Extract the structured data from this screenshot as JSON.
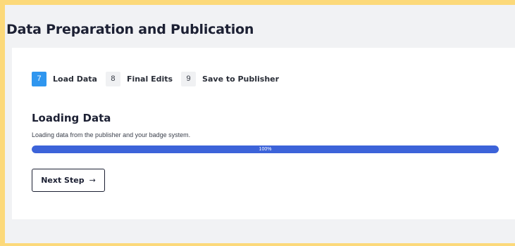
{
  "page": {
    "title": "Data Preparation and Publication"
  },
  "steps": [
    {
      "number": "7",
      "label": "Load Data",
      "active": true
    },
    {
      "number": "8",
      "label": "Final Edits",
      "active": false
    },
    {
      "number": "9",
      "label": "Save to Publisher",
      "active": false
    }
  ],
  "section": {
    "title": "Loading Data",
    "description": "Loading data from the publisher and your badge system."
  },
  "progress": {
    "value": 1.0,
    "label": "100%"
  },
  "next_button": {
    "label": "Next Step",
    "icon": "arrow-right-icon",
    "arrow_glyph": "→"
  },
  "colors": {
    "frame_border": "#fcd97a",
    "active_step": "#2f96ef",
    "progress_fill": "#3c63d9"
  }
}
